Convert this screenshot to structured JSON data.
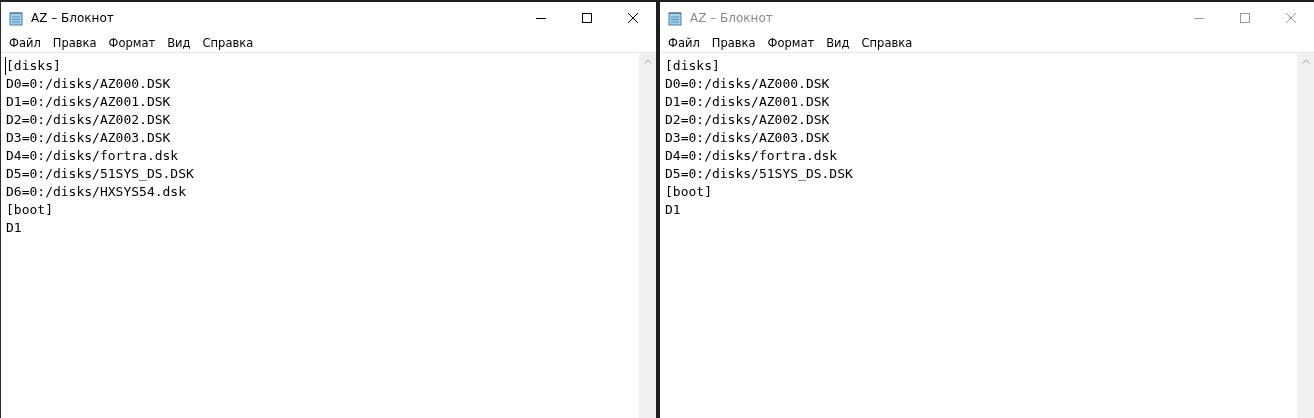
{
  "windows": [
    {
      "title": "AZ – Блокнот",
      "focused": true,
      "menu": [
        "Файл",
        "Правка",
        "Формат",
        "Вид",
        "Справка"
      ],
      "lines": [
        "[disks]",
        "D0=0:/disks/AZ000.DSK",
        "D1=0:/disks/AZ001.DSK",
        "D2=0:/disks/AZ002.DSK",
        "D3=0:/disks/AZ003.DSK",
        "D4=0:/disks/fortra.dsk",
        "D5=0:/disks/51SYS_DS.DSK",
        "D6=0:/disks/HXSYS54.dsk",
        "[boot]",
        "D1"
      ]
    },
    {
      "title": "AZ – Блокнот",
      "focused": false,
      "menu": [
        "Файл",
        "Правка",
        "Формат",
        "Вид",
        "Справка"
      ],
      "lines": [
        "[disks]",
        "D0=0:/disks/AZ000.DSK",
        "D1=0:/disks/AZ001.DSK",
        "D2=0:/disks/AZ002.DSK",
        "D3=0:/disks/AZ003.DSK",
        "D4=0:/disks/fortra.dsk",
        "D5=0:/disks/51SYS_DS.DSK",
        "[boot]",
        "D1"
      ]
    }
  ]
}
